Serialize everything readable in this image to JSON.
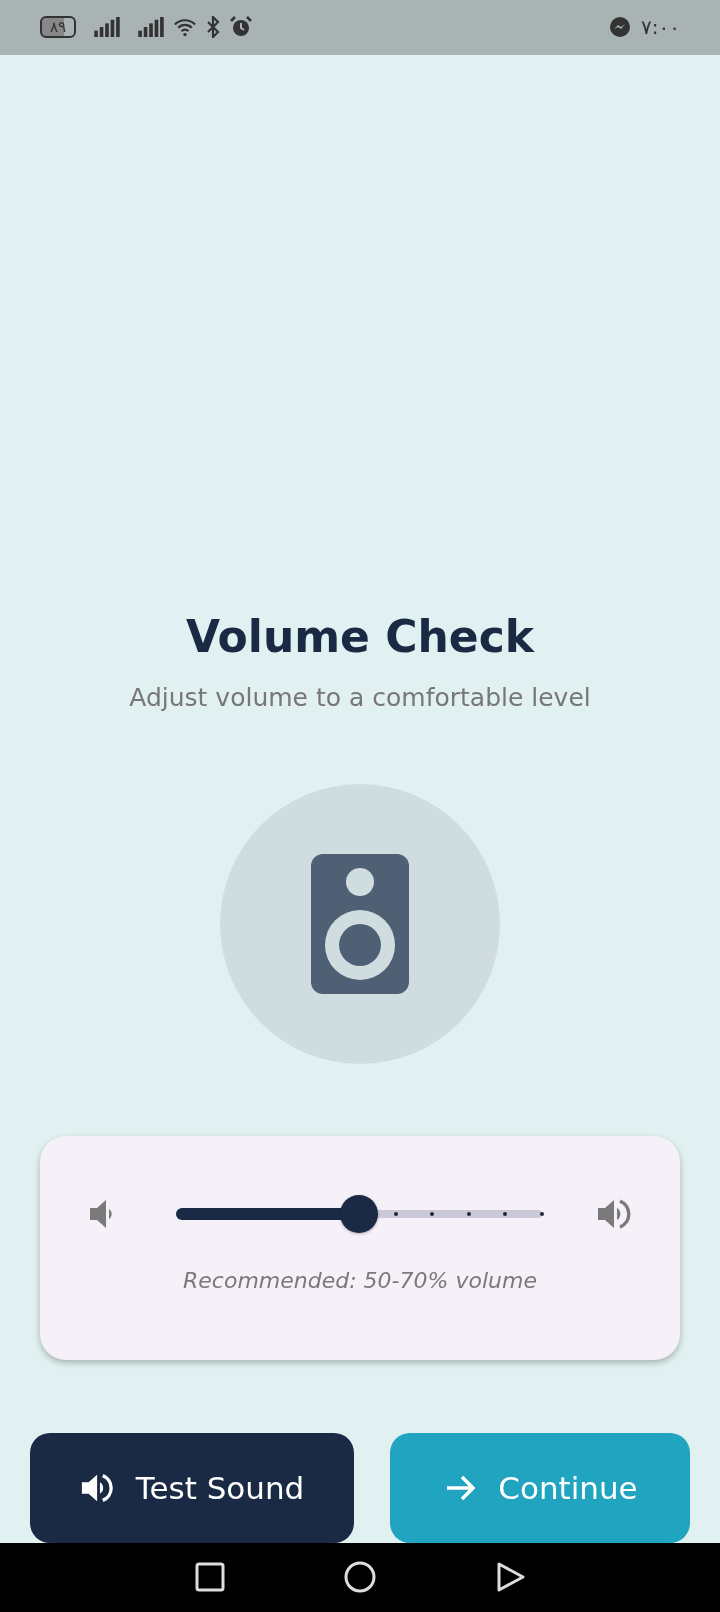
{
  "status_bar": {
    "battery": "٨٩",
    "time": "٧:٠٠"
  },
  "title": "Volume Check",
  "subtitle": "Adjust volume to a comfortable level",
  "volume_slider": {
    "level": 0.5
  },
  "hint": "Recommended: 50-70% volume",
  "buttons": [
    {
      "label": "Test Sound",
      "kind": "primary"
    },
    {
      "label": "Continue",
      "kind": "accent"
    }
  ]
}
